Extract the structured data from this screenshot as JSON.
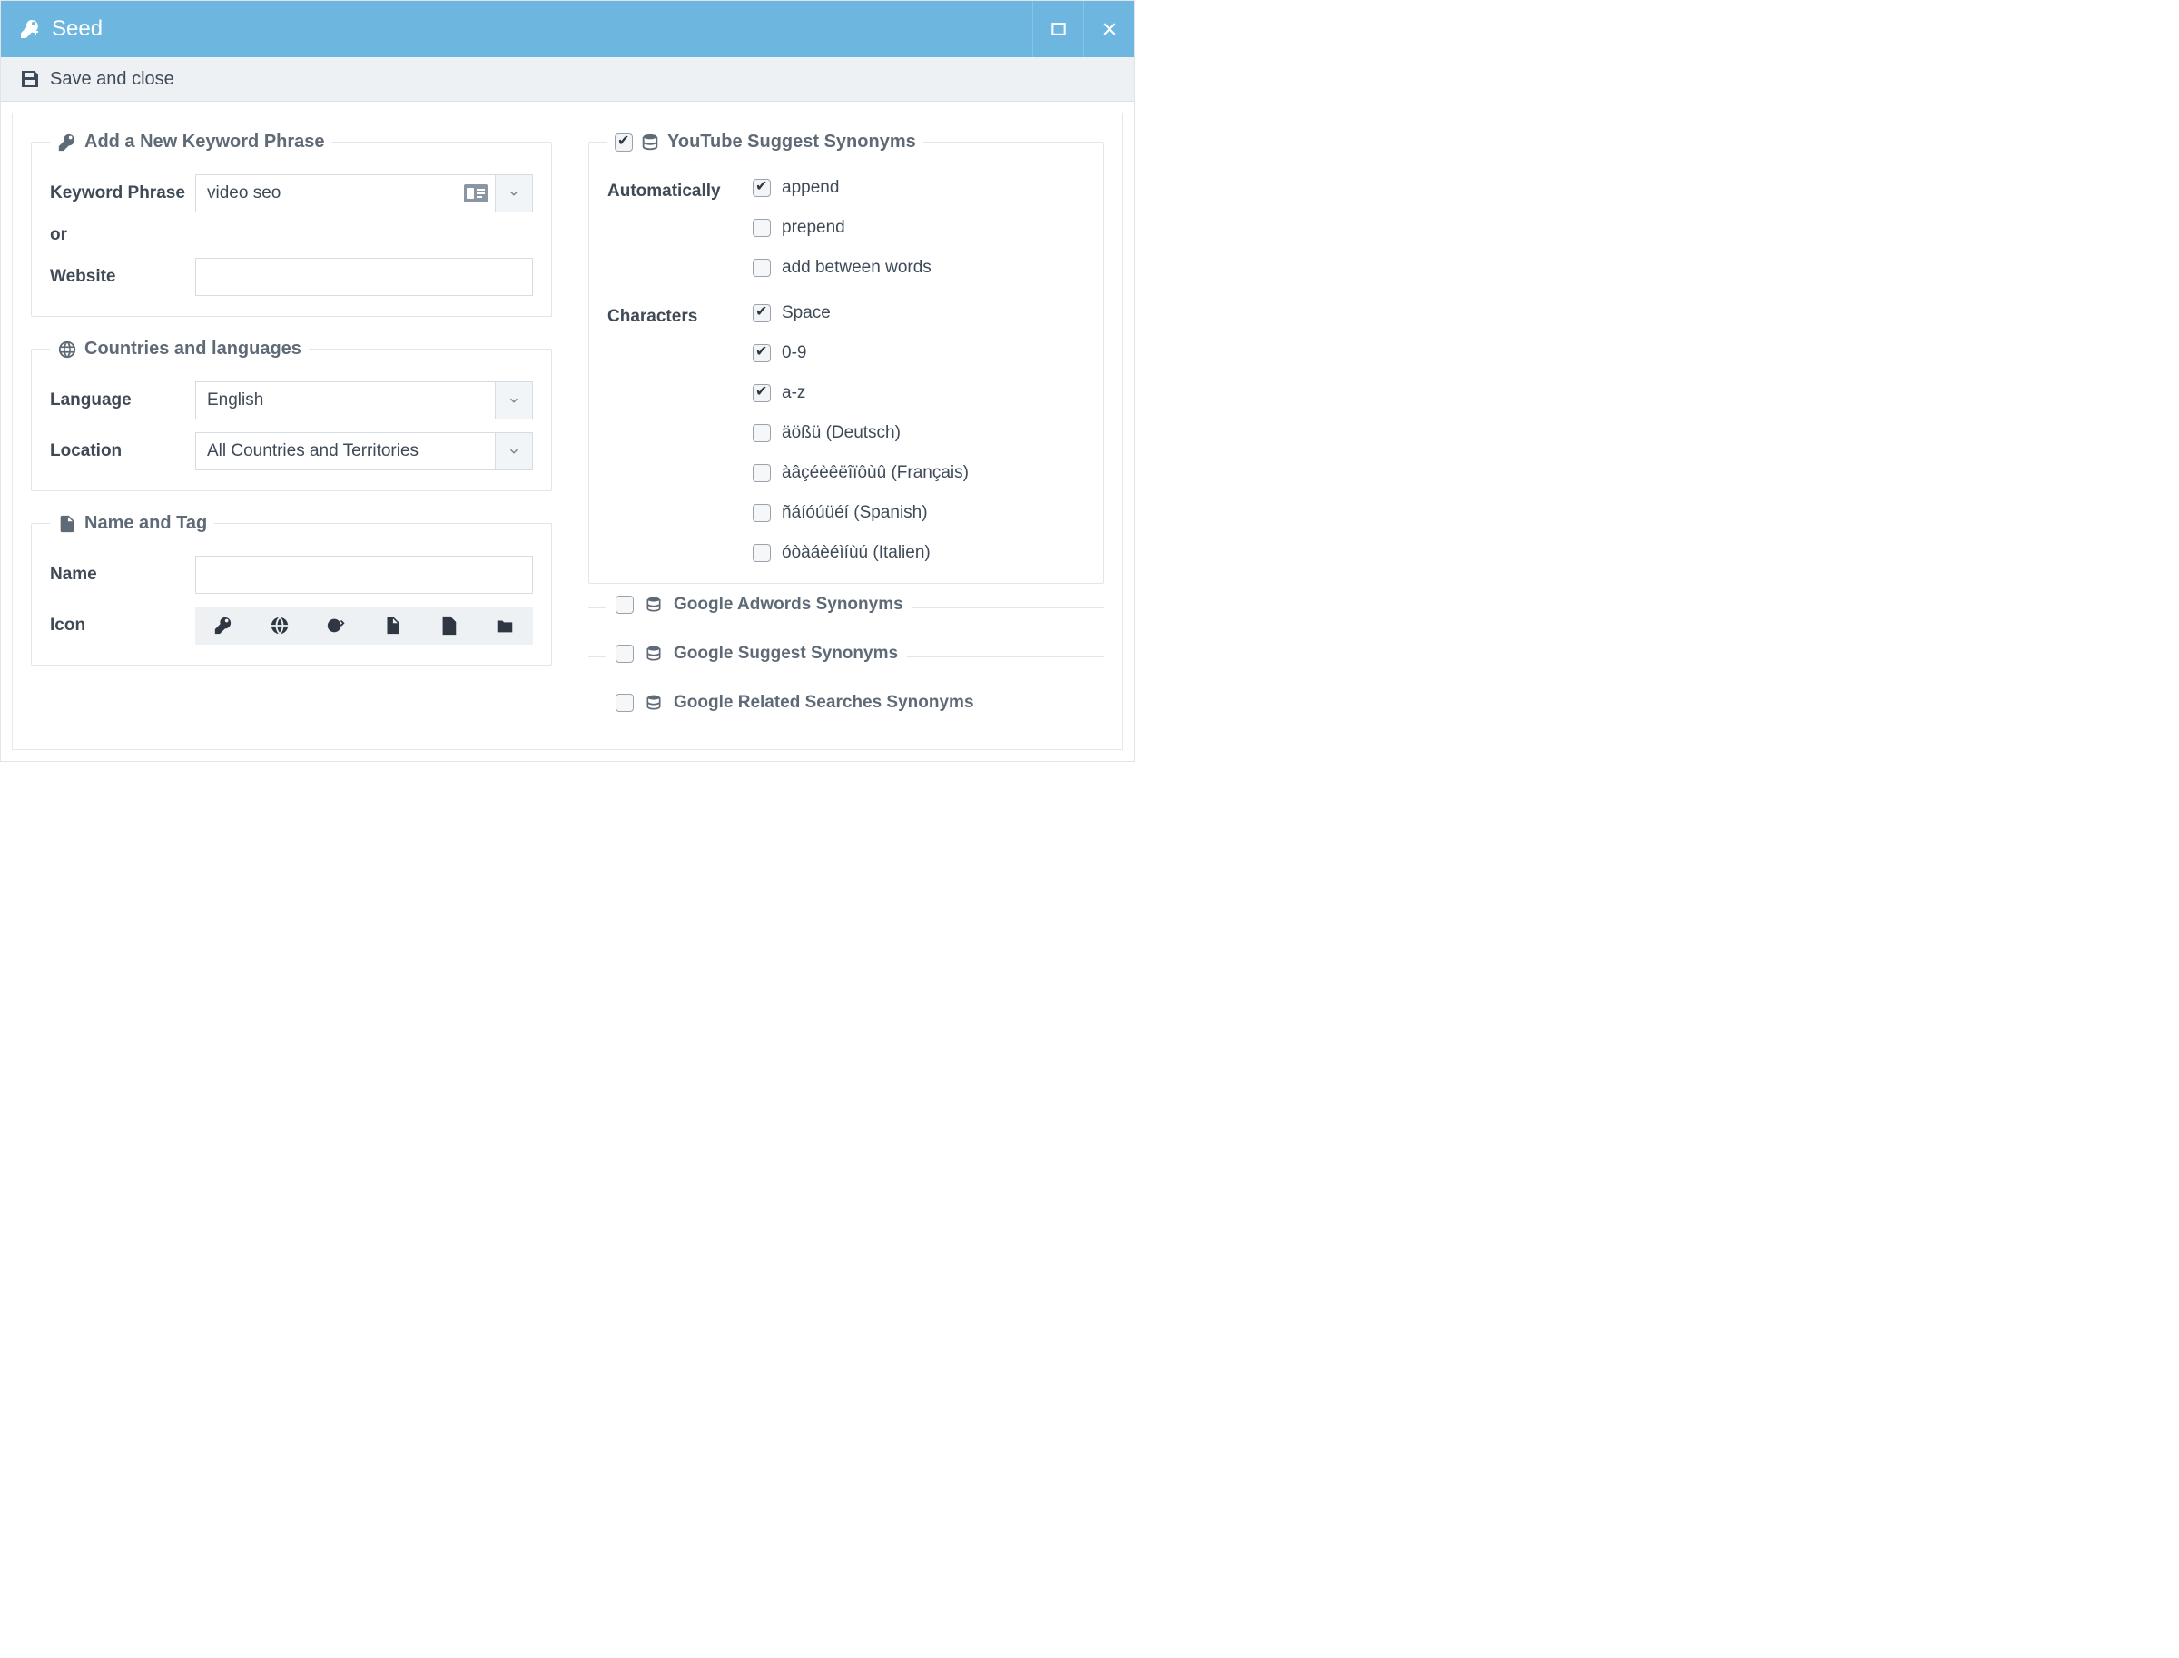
{
  "window": {
    "title": "Seed"
  },
  "toolbar": {
    "save_close": "Save and close"
  },
  "keyword_section": {
    "legend": "Add a New Keyword Phrase",
    "keyword_label": "Keyword Phrase",
    "keyword_value": "video seo",
    "or": "or",
    "website_label": "Website",
    "website_value": ""
  },
  "countries_section": {
    "legend": "Countries and languages",
    "language_label": "Language",
    "language_value": "English",
    "location_label": "Location",
    "location_value": "All Countries and Territories"
  },
  "nametag_section": {
    "legend": "Name and Tag",
    "name_label": "Name",
    "name_value": "",
    "icon_label": "Icon"
  },
  "youtube_section": {
    "legend": "YouTube Suggest Synonyms",
    "enabled": true,
    "auto_label": "Automatically",
    "auto_opts": [
      {
        "label": "append",
        "checked": true
      },
      {
        "label": "prepend",
        "checked": false
      },
      {
        "label": "add between words",
        "checked": false
      }
    ],
    "chars_label": "Characters",
    "chars_opts": [
      {
        "label": "Space",
        "checked": true
      },
      {
        "label": "0-9",
        "checked": true
      },
      {
        "label": "a-z",
        "checked": true
      },
      {
        "label": "äößü (Deutsch)",
        "checked": false
      },
      {
        "label": "àâçéèêëîïôùû (Français)",
        "checked": false
      },
      {
        "label": "ñáíóúüéí (Spanish)",
        "checked": false
      },
      {
        "label": "óòàáèéìíùú (Italien)",
        "checked": false
      }
    ]
  },
  "collapsed_sections": [
    {
      "label": "Google Adwords Synonyms",
      "checked": false
    },
    {
      "label": "Google Suggest Synonyms",
      "checked": false
    },
    {
      "label": "Google Related Searches Synonyms",
      "checked": false
    }
  ]
}
